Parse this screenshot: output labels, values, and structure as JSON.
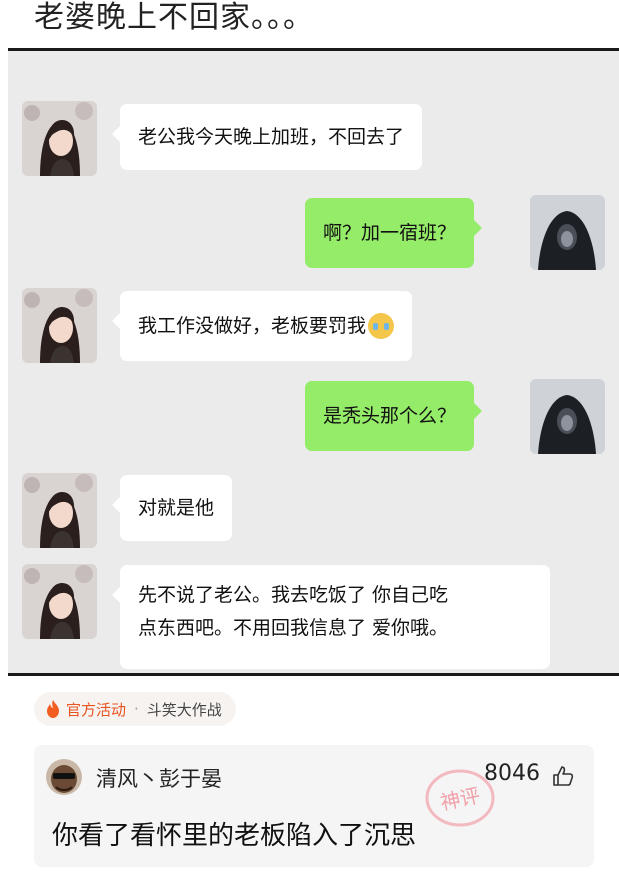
{
  "post": {
    "title": "老婆晚上不回家。。。"
  },
  "chat": {
    "messages": [
      {
        "side": "in",
        "text": "老公我今天晚上加班，不回去了"
      },
      {
        "side": "out",
        "text": "啊？加一宿班？"
      },
      {
        "side": "in",
        "text": "我工作没做好，老板要罚我",
        "emoji": "crying-face-icon"
      },
      {
        "side": "out",
        "text": "是秃头那个么？"
      },
      {
        "side": "in",
        "text": "对就是他"
      },
      {
        "side": "in",
        "text": "先不说了老公。我去吃饭了 你自己吃\n点东西吧。不用回我信息了 爱你哦。"
      }
    ]
  },
  "tag": {
    "icon": "fire-icon",
    "label": "官方活动",
    "separator": "·",
    "topic": "斗笑大作战"
  },
  "comment": {
    "username": "清风丶彭于晏",
    "likes": "8046",
    "like_icon": "thumbs-up-icon",
    "text": "你看了看怀里的老板陷入了沉思",
    "stamp_text": "神评"
  },
  "colors": {
    "chat_bg": "#ebebeb",
    "bubble_out": "#95ec69",
    "bubble_in": "#ffffff",
    "tag_accent": "#e8531f",
    "stamp": "#e87a86"
  }
}
